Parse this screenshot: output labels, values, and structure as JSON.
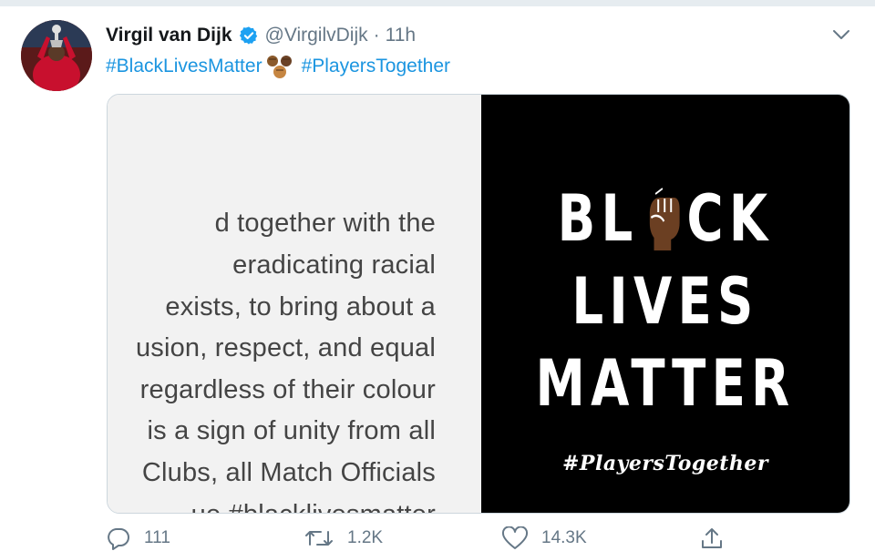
{
  "tweet": {
    "author_name": "Virgil van Dijk",
    "handle": "@VirgilvDijk",
    "separator": "·",
    "time": "11h",
    "hashtags": [
      "#BlackLivesMatter",
      "#PlayersTogether"
    ]
  },
  "media": {
    "left_text_lines": [
      "d together with the",
      "eradicating racial",
      "exists, to bring about a",
      "usion, respect, and equal",
      "regardless of their colour",
      " is a sign of unity from all",
      "Clubs, all Match Officials",
      "ue #blacklivesmatter"
    ],
    "right": {
      "line1_left": "BL",
      "line1_right": "CK",
      "line2": "LIVES",
      "line3": "MATTER",
      "tag": "#PlayersTogether"
    }
  },
  "actions": {
    "reply_count": "111",
    "retweet_count": "1.2K",
    "like_count": "14.3K"
  },
  "colors": {
    "link": "#1b95e0",
    "muted": "#657786",
    "verified": "#1da1f2"
  },
  "icons": [
    "verified-badge-icon",
    "chevron-down-icon",
    "fist-emoji-icon",
    "raised-fist-icon",
    "reply-icon",
    "retweet-icon",
    "like-icon",
    "share-icon"
  ]
}
